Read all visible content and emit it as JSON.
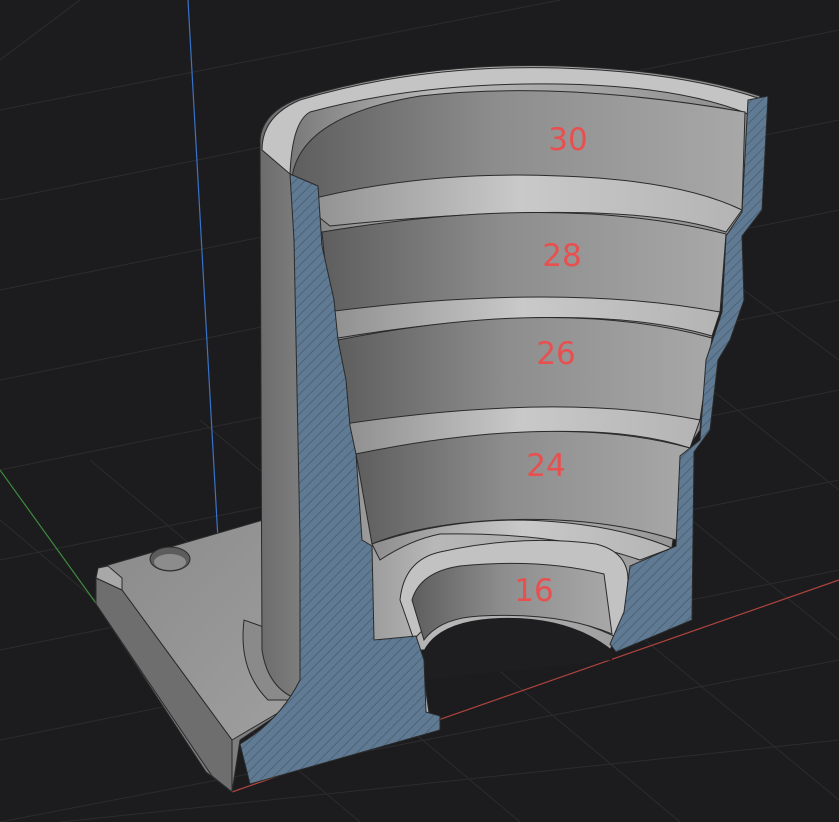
{
  "viewport": {
    "background": "#1c1c1e",
    "grid_color": "#2c2c2e",
    "axis_colors": {
      "x": "#b0443e",
      "y": "#3f8a3c",
      "z": "#3b72c8"
    }
  },
  "model": {
    "surface_color": "#9a9a9a",
    "section_color": "#5f7a92",
    "section_hatch_color": "#4a6378",
    "edge_color": "#2a2a2a",
    "step_labels": [
      "30",
      "28",
      "26",
      "24",
      "16"
    ],
    "label_color": "#e8504f"
  }
}
